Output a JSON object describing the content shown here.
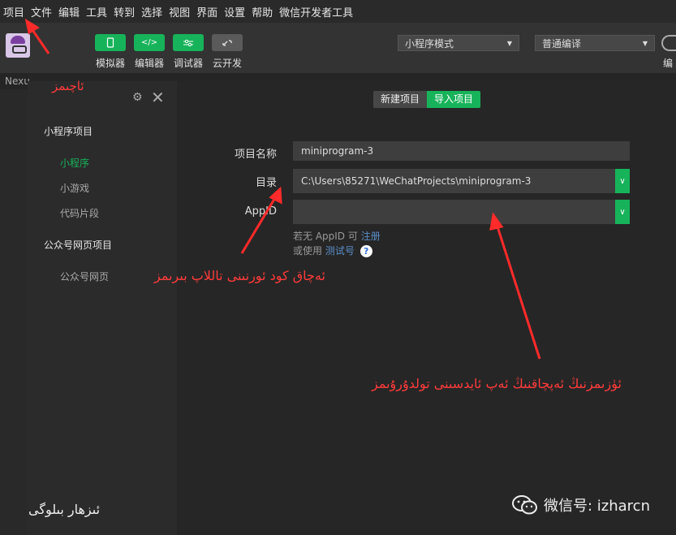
{
  "menu": [
    "项目",
    "文件",
    "编辑",
    "工具",
    "转到",
    "选择",
    "视图",
    "界面",
    "设置",
    "帮助",
    "微信开发者工具"
  ],
  "toolbar": {
    "buttons": [
      {
        "label": "模拟器",
        "icon": "phone-icon"
      },
      {
        "label": "编辑器",
        "icon": "code-icon"
      },
      {
        "label": "调试器",
        "icon": "sliders-icon"
      },
      {
        "label": "云开发",
        "icon": "cloud-link-icon"
      }
    ],
    "mode_select": "小程序模式",
    "compile_select": "普通编译",
    "edit_cut": "编"
  },
  "strip": {
    "nexus_label": "Nexu"
  },
  "sidebar": {
    "title_ug": "ئاچىمز",
    "section1": "小程序项目",
    "items1": [
      "小程序",
      "小游戏",
      "代码片段"
    ],
    "section2": "公众号网页项目",
    "items2": [
      "公众号网页"
    ]
  },
  "main": {
    "tab_new": "新建项目",
    "tab_import": "导入项目",
    "name_label": "项目名称",
    "name_value": "miniprogram-3",
    "dir_label": "目录",
    "dir_value": "C:\\Users\\85271\\WeChatProjects\\miniprogram-3",
    "appid_label": "AppID",
    "appid_value": "",
    "hint1_prefix": "若无 AppID 可",
    "hint1_link": "注册",
    "hint2_prefix": "或使用",
    "hint2_link": "测试号",
    "hint_q": "?"
  },
  "annotations": {
    "a1": "ئەچاق كود ئورنىنى تاللاپ بىرىمز",
    "a2": "ئۈزىمزنىڭ ئەپچاقنىڭ ئەپ ئايدسىنى تولدۇرۇىمز"
  },
  "footer": {
    "left": "ئىزهار بىلوگى",
    "wechat": "微信号: izharcn"
  },
  "colors": {
    "accent": "#17b35a",
    "annotation": "#ff3b3b",
    "link": "#5b8ec9"
  }
}
